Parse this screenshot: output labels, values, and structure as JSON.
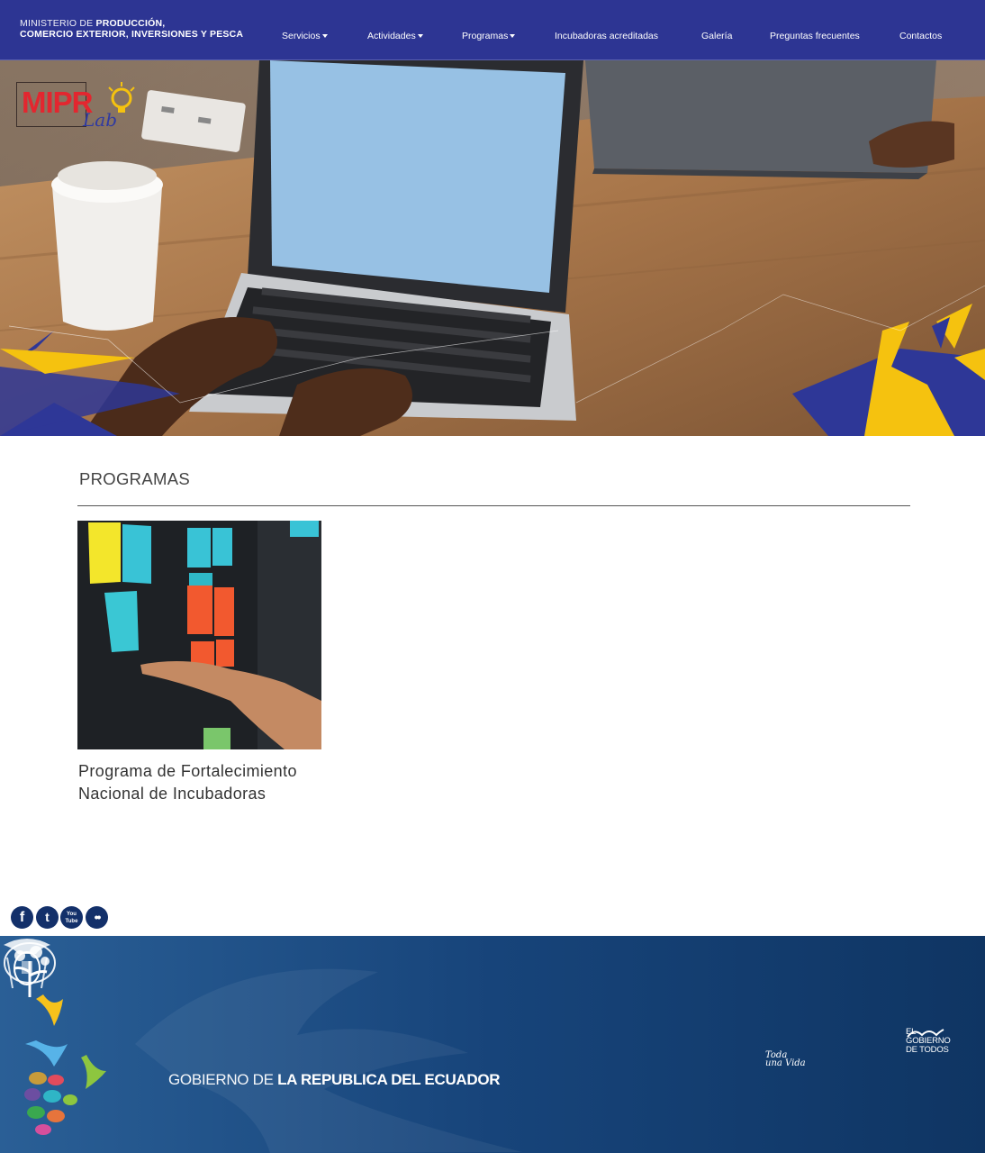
{
  "header": {
    "ministry_line1_light": "MINISTERIO DE ",
    "ministry_line1_bold": "PRODUCCIÓN,",
    "ministry_line2": "COMERCIO EXTERIOR, INVERSIONES Y PESCA",
    "nav": [
      {
        "label": "Servicios",
        "dropdown": true
      },
      {
        "label": "Actividades",
        "dropdown": true
      },
      {
        "label": "Programas",
        "dropdown": true
      },
      {
        "label": "Incubadoras acreditadas",
        "dropdown": false
      },
      {
        "label": "Galería",
        "dropdown": false
      },
      {
        "label": "Preguntas frecuentes",
        "dropdown": false
      },
      {
        "label": "Contactos",
        "dropdown": false
      }
    ]
  },
  "hero": {
    "logo_main": "MIPR",
    "logo_sub": "Lab"
  },
  "main": {
    "section_title": "PROGRAMAS",
    "cards": [
      {
        "title_line1": "Programa de Fortalecimiento",
        "title_line2": "Nacional de Incubadoras"
      }
    ]
  },
  "social": [
    {
      "name": "facebook-icon",
      "glyph": "f"
    },
    {
      "name": "twitter-icon",
      "glyph": "t"
    },
    {
      "name": "youtube-icon",
      "glyph": "You Tube"
    },
    {
      "name": "flickr-icon",
      "glyph": "••"
    }
  ],
  "footer": {
    "gov_light": "GOBIERNO DE ",
    "gov_bold": "LA REPUBLICA DEL ECUADOR",
    "toda_line1": "Toda",
    "toda_line2": "una Vida",
    "gdt_line1": "EL",
    "gdt_line2": "GOBIERNO",
    "gdt_line3": "DE TODOS"
  },
  "colors": {
    "nav_bg": "#2d3593",
    "footer_bg": "#133a6a",
    "accent_yellow": "#f5c20f",
    "logo_red": "#e3262f"
  }
}
